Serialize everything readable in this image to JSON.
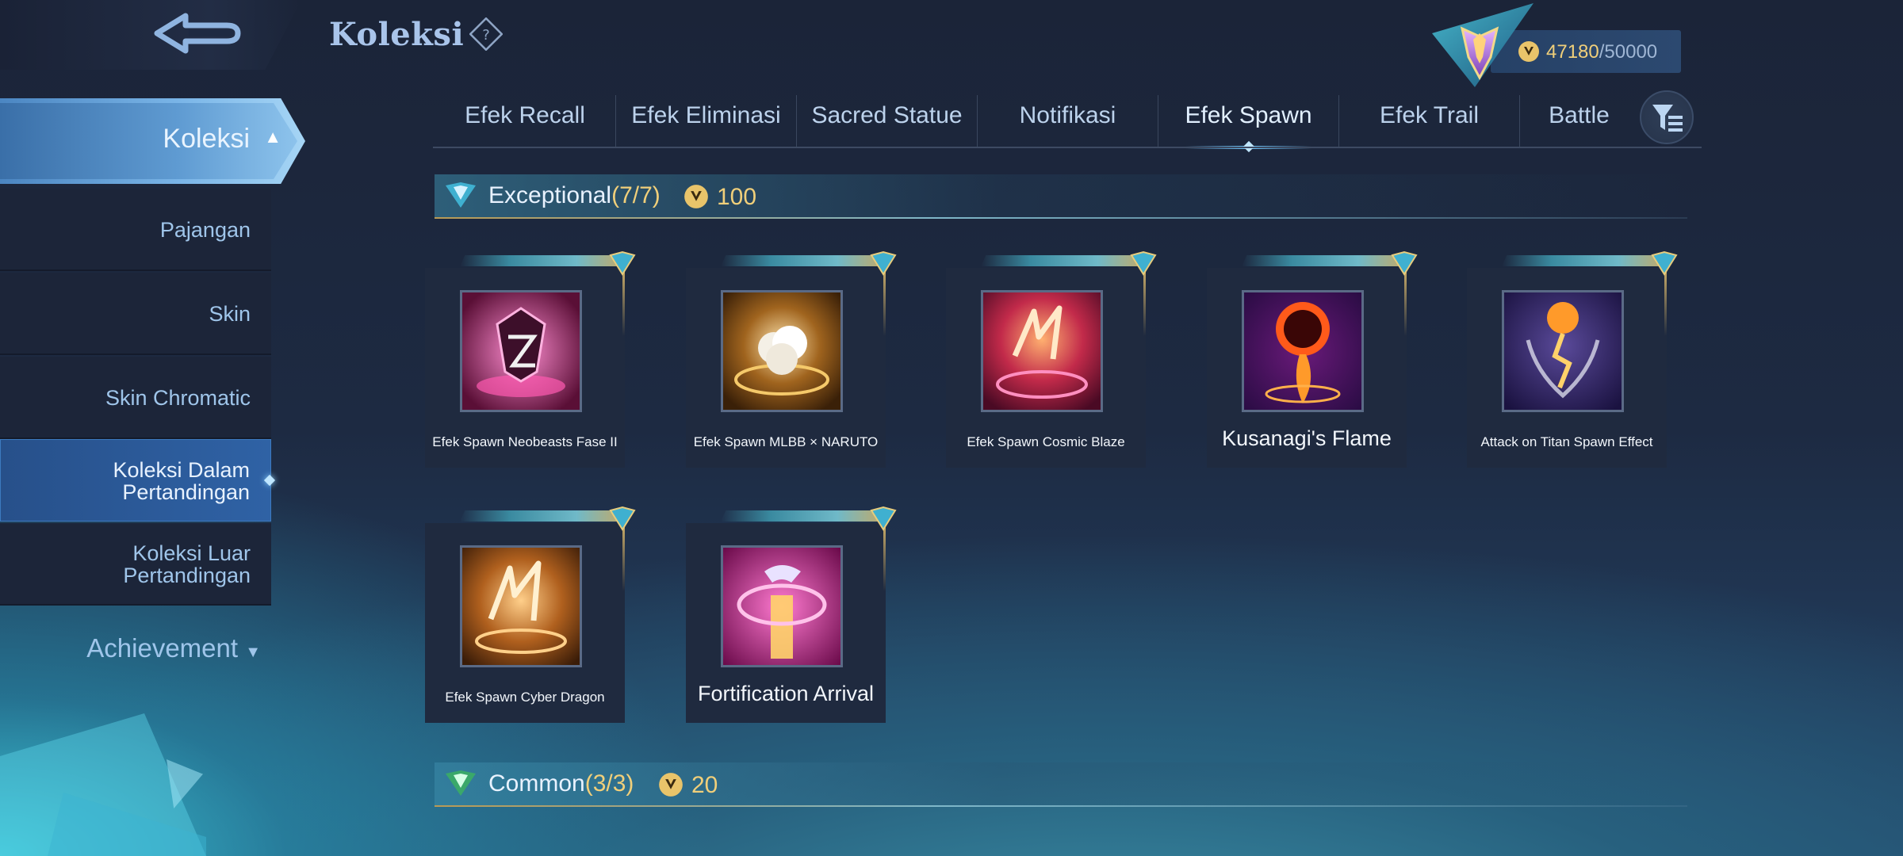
{
  "header": {
    "title": "Koleksi",
    "currency_amount": "47180",
    "currency_max": "/50000"
  },
  "sidebar": {
    "main_label": "Koleksi",
    "items": [
      {
        "label": "Pajangan"
      },
      {
        "label": "Skin"
      },
      {
        "label": "Skin Chromatic"
      },
      {
        "label": "Koleksi Dalam\nPertandingan",
        "active": true
      },
      {
        "label": "Koleksi Luar\nPertandingan"
      }
    ],
    "achievement_label": "Achievement"
  },
  "tabs": [
    {
      "label": "Efek Recall"
    },
    {
      "label": "Efek Eliminasi"
    },
    {
      "label": "Sacred Statue"
    },
    {
      "label": "Notifikasi"
    },
    {
      "label": "Efek Spawn",
      "active": true
    },
    {
      "label": "Efek Trail"
    },
    {
      "label": "Battle"
    }
  ],
  "sections": {
    "exceptional": {
      "title": "Exceptional",
      "count": "(7/7)",
      "cost": "100"
    },
    "common": {
      "title": "Common",
      "count": "(3/3)",
      "cost": "20"
    }
  },
  "items": [
    {
      "name": "Efek Spawn Neobeasts Fase II",
      "icon": "neobeasts-spawn-art"
    },
    {
      "name": "Efek Spawn MLBB × NARUTO",
      "icon": "naruto-spawn-art"
    },
    {
      "name": "Efek Spawn Cosmic Blaze",
      "icon": "cosmic-blaze-spawn-art"
    },
    {
      "name": "Kusanagi's Flame",
      "icon": "kusanagi-flame-art"
    },
    {
      "name": "Attack on Titan Spawn Effect",
      "icon": "titan-spawn-art"
    },
    {
      "name": "Efek Spawn Cyber Dragon",
      "icon": "cyber-dragon-spawn-art"
    },
    {
      "name": "Fortification Arrival",
      "icon": "fortification-arrival-art"
    }
  ],
  "colors": {
    "accent_gold": "#f0cf7a",
    "active_blue": "#2f62a5",
    "text_light": "#d8e6f5"
  }
}
